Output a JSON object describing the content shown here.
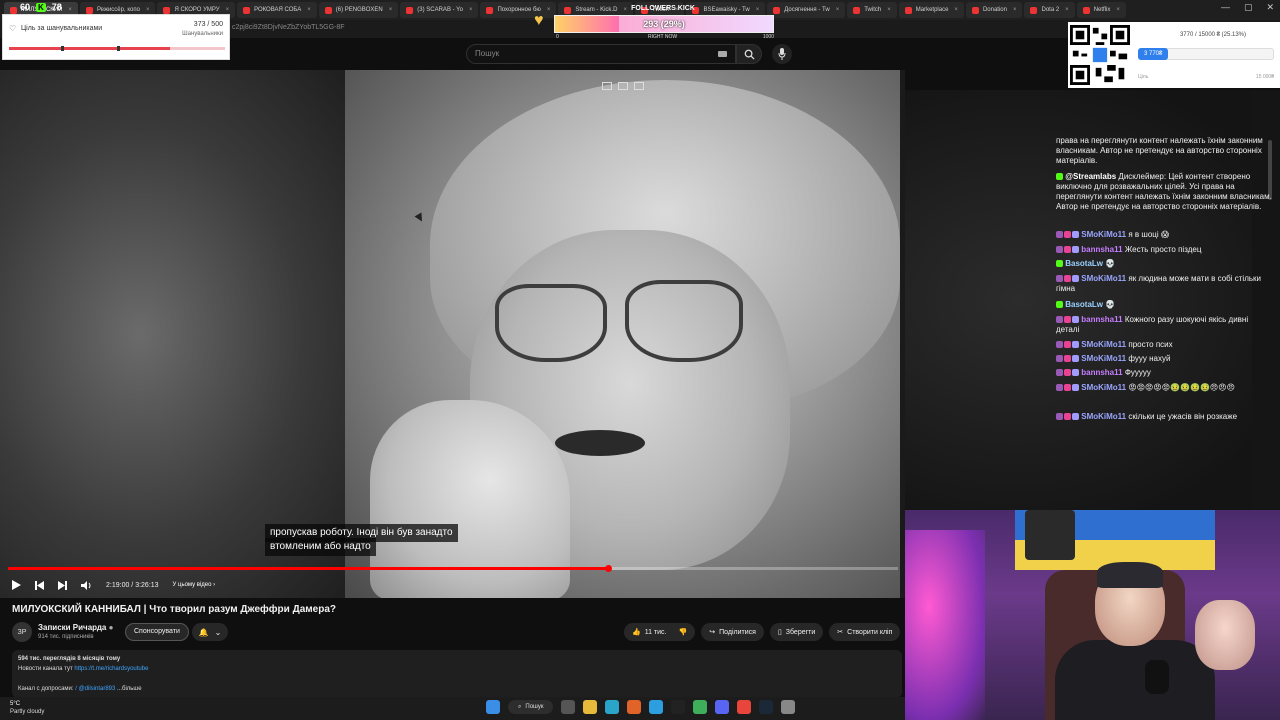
{
  "browser": {
    "tabs": [
      {
        "label": "МИЛУОКСКИЙ",
        "active": true
      },
      {
        "label": "Режиссёр, копо",
        "active": false
      },
      {
        "label": "Я СКОРО УМРУ",
        "active": false
      },
      {
        "label": "РОКОВАЯ СОБА",
        "active": false
      },
      {
        "label": "(6) PENGBOXEN",
        "active": false
      },
      {
        "label": "(3) SCARAB - Yo",
        "active": false
      },
      {
        "label": "Похоронное бю",
        "active": false
      },
      {
        "label": "Stream - Kick.D",
        "active": false
      },
      {
        "label": "Twitch",
        "active": false
      },
      {
        "label": "BSEawaisky - Tw",
        "active": false
      },
      {
        "label": "Досягнення - Tw",
        "active": false
      },
      {
        "label": "Twitch",
        "active": false
      },
      {
        "label": "Marketplace",
        "active": false
      },
      {
        "label": "Donation",
        "active": false
      },
      {
        "label": "Dota 2",
        "active": false
      },
      {
        "label": "Netflix",
        "active": false
      }
    ],
    "url_fragment": "c2pj8ci9Zt8DjvNeZbZYobTL5GG-8F"
  },
  "overlays": {
    "counter_a": "60",
    "counter_b": "78",
    "goal": {
      "title": "Ціль за шанувальниками",
      "count": "373 / 500",
      "sublabel": "Шанувальники",
      "fraction": 0.746
    },
    "followers_kick": {
      "label": "FOLLOWERS KICK",
      "value_text": "293 (29%)",
      "fraction": 0.293,
      "min": "0",
      "mid": "RIGHT NOW",
      "max": "1000"
    },
    "donation": {
      "goal_text": "3770 / 15000 ₴ (25.13%)",
      "amount": "3 770₴",
      "label": "Ціль",
      "max": "15 000₴"
    }
  },
  "masthead": {
    "search_placeholder": "Пошук"
  },
  "video": {
    "subtitle_line1": "пропускав роботу. Іноді він був занадто",
    "subtitle_line2": "втомленим або надто",
    "time": "2:19:00 / 3:26:13",
    "chapter": "У цьому відео",
    "progress_fraction": 0.6737
  },
  "meta": {
    "title": "МИЛУОКСКИЙ КАННИБАЛ | Что творил разум Джеффри Дамера?",
    "channel_avatar": "ЗР",
    "channel_name": "Записки Ричарда",
    "subscribers": "914 тис. підписників",
    "sponsor_label": "Спонсорувати",
    "likes": "11 тис.",
    "share_label": "Поділитися",
    "save_label": "Зберегти",
    "clip_label": "Створити кліп",
    "stats": "594 тис. переглядів  8 місяців тому",
    "desc_line1_prefix": "Новости канала тут",
    "desc_line1_link": "https://t.me/richardsyoutube",
    "desc_line2_prefix": "Канал с допросами:",
    "desc_line2_link": "/ @dilsintar893",
    "desc_more": "...більше"
  },
  "chat": {
    "messages": [
      {
        "user": "",
        "text": "права на переглянути контент належать їхнім законним власникам. Автор не претендує на авторство сторонніх матеріалів.",
        "color": "#f0f0f0"
      },
      {
        "user": "@Streamlabs",
        "text": "Дисклеймер: Цей контент створено виключно для розважальних цілей. Усі права на переглянути контент належать їхнім законним власникам. Автор не претендує на авторство сторонніх матеріалів.",
        "color": "#ffffff"
      },
      {
        "user": "SMoKiMo11",
        "text": "я в шоці 😱",
        "color": "#9aa6ff"
      },
      {
        "user": "bannsha11",
        "text": "Жесть просто піздец",
        "color": "#c77dff"
      },
      {
        "user": "BasotaLw",
        "text": "💀",
        "color": "#9ad0ff"
      },
      {
        "user": "SMoKiMo11",
        "text": "як людина може мати в собі стільки гімна",
        "color": "#9aa6ff"
      },
      {
        "user": "BasotaLw",
        "text": "💀",
        "color": "#9ad0ff"
      },
      {
        "user": "bannsha11",
        "text": "Кожного разу шокуючі якісь дивні деталі",
        "color": "#c77dff"
      },
      {
        "user": "SMoKiMo11",
        "text": "просто псих",
        "color": "#9aa6ff"
      },
      {
        "user": "SMoKiMo11",
        "text": "фууу нахуй",
        "color": "#9aa6ff"
      },
      {
        "user": "bannsha11",
        "text": "Фууууу",
        "color": "#c77dff"
      },
      {
        "user": "SMoKiMo11",
        "text": "😡😡😡😡😡🤢🤢🤢🤢😠😠😠",
        "color": "#9aa6ff"
      },
      {
        "user": "SMoKiMo11",
        "text": "скільки це ужасів він розкаже",
        "color": "#9aa6ff"
      }
    ]
  },
  "taskbar": {
    "temp": "5°C",
    "weather": "Partly cloudy",
    "search": "Пошук"
  },
  "colors": {
    "youtube_red": "#ff0000",
    "kick_green": "#53fc18",
    "link_blue": "#3ea6ff",
    "donation_blue": "#2f80ed"
  }
}
